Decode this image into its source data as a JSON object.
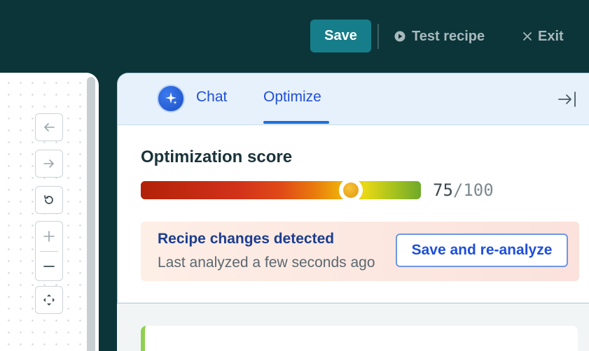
{
  "toolbar": {
    "save_label": "Save",
    "test_label": "Test recipe",
    "exit_label": "Exit"
  },
  "canvas_controls": {
    "back": "back-arrow-icon",
    "forward": "forward-arrow-icon",
    "reset": "reset-icon",
    "zoom_in": "plus-icon",
    "zoom_out": "minus-icon",
    "fit": "move-icon"
  },
  "panel": {
    "tabs": [
      {
        "label": "Chat",
        "active": false
      },
      {
        "label": "Optimize",
        "active": true
      }
    ],
    "score": {
      "title": "Optimization score",
      "value": "75",
      "separator": "/",
      "max": "100",
      "fraction": 0.75
    },
    "alert": {
      "title": "Recipe changes detected",
      "subtitle": "Last analyzed a few seconds ago",
      "button": "Save and re-analyze"
    }
  },
  "colors": {
    "topbar_bg": "#0c353a",
    "save_button": "#167e8a",
    "accent_blue": "#1f4fd8",
    "alert_bg": "#fdeee6",
    "lower_card_accent": "#8fd14f"
  }
}
